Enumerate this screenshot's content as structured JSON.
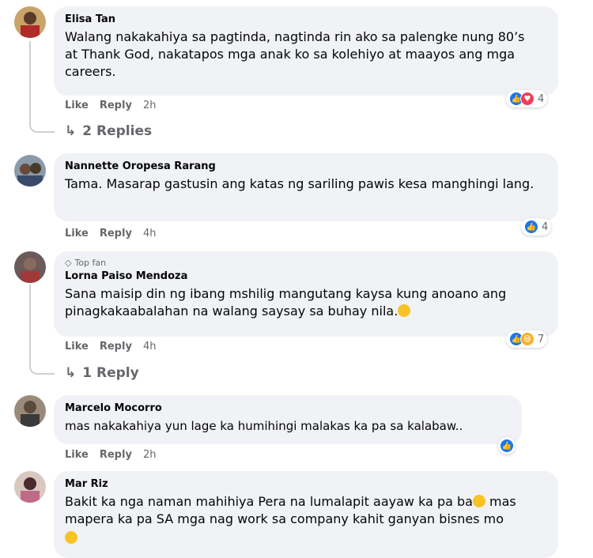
{
  "comments": [
    {
      "name": "Elisa Tan",
      "top_fan": "",
      "text": "Walang nakakahiya sa pagtinda, nagtinda rin ako sa palengke nung 80’s at Thank God, nakatapos mga anak ko sa kolehiyo at maayos ang mga careers.",
      "like": "Like",
      "reply": "Reply",
      "time": "2h",
      "reaction_count": "4",
      "reactions": [
        "like-icon",
        "love-icon"
      ],
      "replies_label": "2 Replies"
    },
    {
      "name": "Nannette Oropesa Rarang",
      "top_fan": "",
      "text": "Tama. Masarap gastusin ang katas ng sariling pawis kesa manghingi lang.",
      "like": "Like",
      "reply": "Reply",
      "time": "4h",
      "reaction_count": "4",
      "reactions": [
        "like-icon"
      ]
    },
    {
      "name": "Lorna Paiso Mendoza",
      "top_fan": "Top fan",
      "text": "Sana maisip din ng ibang mshilig mangutang kaysa kung anoano ang pinagkakaabalahan na walang saysay sa buhay nila.",
      "like": "Like",
      "reply": "Reply",
      "time": "4h",
      "reaction_count": "7",
      "reactions": [
        "like-icon",
        "haha-icon"
      ],
      "replies_label": "1 Reply"
    },
    {
      "name": "Marcelo Mocorro",
      "top_fan": "",
      "text": "mas nakakahiya yun lage ka humihingi malakas ka pa sa kalabaw..",
      "like": "Like",
      "reply": "Reply",
      "time": "2h",
      "reaction_count": "",
      "reactions": [
        "like-icon"
      ]
    },
    {
      "name": "Mar Riz",
      "top_fan": "",
      "text": "Bakit ka nga naman mahihiya Pera na lumalapit aayaw ka pa ba",
      "text2": " mas mapera ka pa SA mga nag work sa company kahit ganyan bisnes mo"
    }
  ]
}
